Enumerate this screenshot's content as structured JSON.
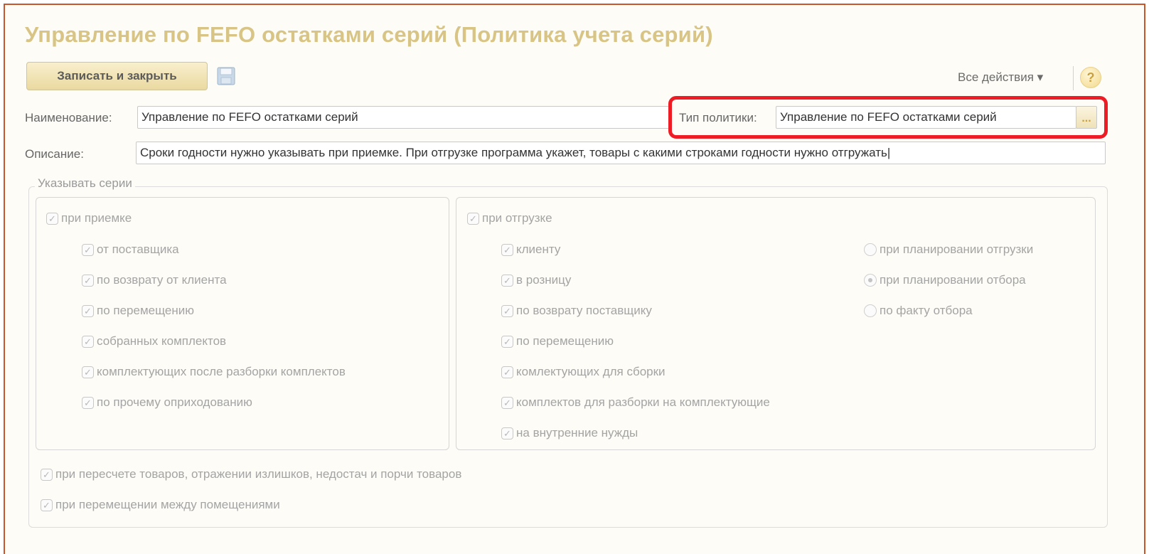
{
  "window": {
    "title": "Управление по FEFO остатками серий (Политика учета серий)"
  },
  "toolbar": {
    "save_close_label": "Записать и закрыть",
    "save_icon": "floppy-disk-icon",
    "all_actions_label": "Все действия ▾",
    "help_label": "?"
  },
  "form": {
    "name_label": "Наименование:",
    "name_value": "Управление по FEFO остатками серий",
    "policy_type_label": "Тип политики:",
    "policy_type_value": "Управление по FEFO остатками серий",
    "ellipsis_label": "...",
    "description_label": "Описание:",
    "description_value": "Сроки годности нужно указывать при приемке. При отгрузке программа укажет, товары с какими строками годности нужно отгружать|"
  },
  "series": {
    "group_title": "Указывать серии",
    "receipt": {
      "label": "при приемке",
      "checked": true,
      "items": [
        {
          "label": "от поставщика",
          "checked": true
        },
        {
          "label": "по возврату от клиента",
          "checked": true
        },
        {
          "label": "по перемещению",
          "checked": true
        },
        {
          "label": "собранных комплектов",
          "checked": true
        },
        {
          "label": "комплектующих после разборки комплектов",
          "checked": true
        },
        {
          "label": "по прочему оприходованию",
          "checked": true
        }
      ]
    },
    "shipment": {
      "label": "при отгрузке",
      "checked": true,
      "items": [
        {
          "label": "клиенту",
          "checked": true
        },
        {
          "label": "в розницу",
          "checked": true
        },
        {
          "label": "по возврату поставщику",
          "checked": true
        },
        {
          "label": "по перемещению",
          "checked": true
        },
        {
          "label": "комлектующих для сборки",
          "checked": true
        },
        {
          "label": "комплектов для разборки на комплектующие",
          "checked": true
        },
        {
          "label": "на внутренние нужды",
          "checked": true
        }
      ],
      "radio": [
        {
          "label": "при планировании отгрузки",
          "selected": false
        },
        {
          "label": "при планировании отбора",
          "selected": true
        },
        {
          "label": "по факту отбора",
          "selected": false
        }
      ]
    },
    "recount": {
      "label": "при пересчете товаров, отражении излишков, недостач и порчи товаров",
      "checked": true
    },
    "room_move": {
      "label": "при перемещении между помещениями",
      "checked": true
    }
  },
  "colors": {
    "title": "#d8c585",
    "frame_border": "#c8562c",
    "highlight": "#ee1c24"
  }
}
